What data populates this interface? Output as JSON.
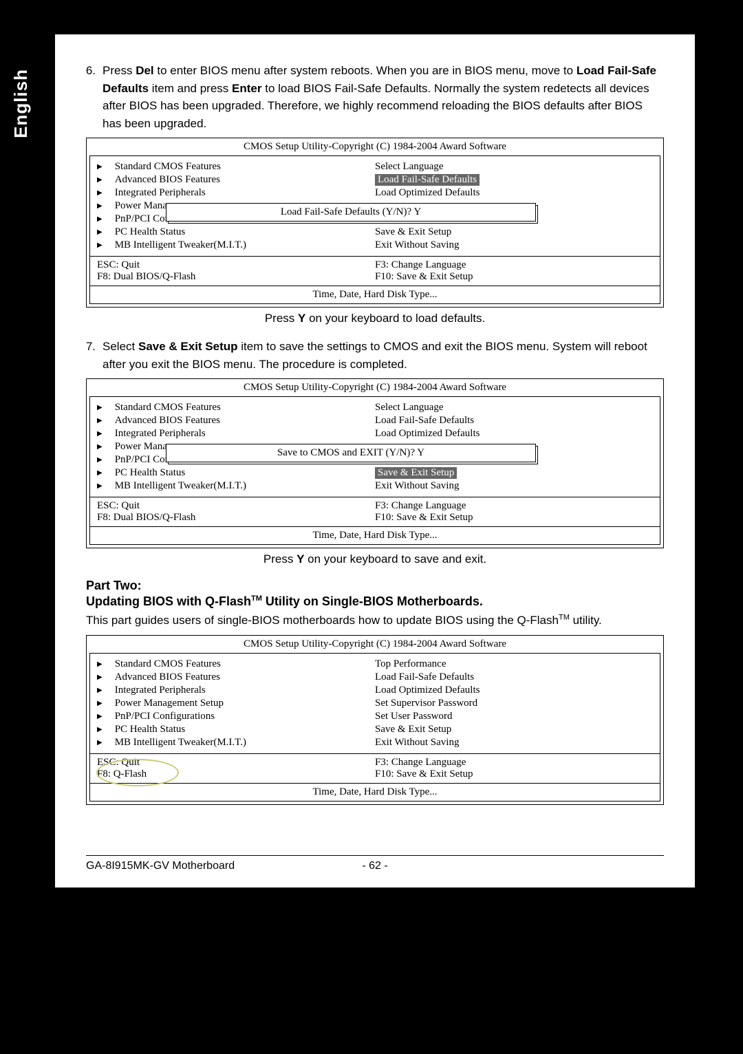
{
  "lang_tab": "English",
  "step6": {
    "num": "6.",
    "t1": "Press ",
    "b1": "Del",
    "t2": " to enter BIOS menu after system reboots. When you are in BIOS menu, move to ",
    "b2": "Load Fail-Safe Defaults",
    "t3": " item and press ",
    "b3": "Enter",
    "t4": " to load BIOS Fail-Safe Defaults. Normally the system redetects all devices after BIOS has been upgraded. Therefore, we highly recommend reloading the BIOS defaults after BIOS has been upgraded."
  },
  "bios1": {
    "title": "CMOS Setup Utility-Copyright (C) 1984-2004 Award Software",
    "left": [
      "Standard CMOS Features",
      "Advanced BIOS Features",
      "Integrated Peripherals",
      "Power Mana",
      "PnP/PCI Cor",
      "PC Health Status",
      "MB Intelligent Tweaker(M.I.T.)"
    ],
    "right": [
      "Select Language",
      "Load Fail-Safe Defaults",
      "Load Optimized Defaults",
      "",
      "",
      "Save & Exit Setup",
      "Exit Without Saving"
    ],
    "right_sel_index": 1,
    "dialog": "Load Fail-Safe Defaults (Y/N)? Y",
    "hints": [
      "ESC: Quit",
      "F3: Change Language",
      "F8: Dual BIOS/Q-Flash",
      "F10: Save & Exit Setup"
    ],
    "footer": "Time, Date, Hard Disk Type..."
  },
  "caption1": {
    "t1": "Press ",
    "b": "Y",
    "t2": " on your keyboard to load defaults."
  },
  "step7": {
    "num": "7.",
    "t1": "Select ",
    "b1": "Save & Exit Setup",
    "t2": " item to save the settings to CMOS and exit the BIOS menu. System will reboot after you exit the BIOS menu. The procedure is completed."
  },
  "bios2": {
    "title": "CMOS Setup Utility-Copyright (C) 1984-2004 Award Software",
    "left": [
      "Standard CMOS Features",
      "Advanced BIOS Features",
      "Integrated Peripherals",
      "Power Mana",
      "PnP/PCI Cor",
      "PC Health Status",
      "MB Intelligent Tweaker(M.I.T.)"
    ],
    "right": [
      "Select Language",
      "Load Fail-Safe Defaults",
      "Load Optimized Defaults",
      "",
      "",
      "Save & Exit Setup",
      "Exit Without Saving"
    ],
    "right_sel_index": 5,
    "dialog": "Save to CMOS and EXIT (Y/N)? Y",
    "hints": [
      "ESC: Quit",
      "F3: Change Language",
      "F8: Dual BIOS/Q-Flash",
      "F10: Save & Exit Setup"
    ],
    "footer": "Time, Date, Hard Disk Type..."
  },
  "caption2": {
    "t1": "Press ",
    "b": "Y",
    "t2": " on your keyboard to save and exit."
  },
  "part_two": "Part Two:",
  "part_two_sub": {
    "t1": "Updating BIOS with Q-Flash",
    "t2": " Utility on Single-BIOS Motherboards."
  },
  "part_two_para": {
    "t1": "This part guides users of single-BIOS motherboards how to update BIOS using the Q-Flash",
    "t2": " utility."
  },
  "bios3": {
    "title": "CMOS Setup Utility-Copyright (C) 1984-2004 Award Software",
    "left": [
      "Standard CMOS Features",
      "Advanced BIOS Features",
      "Integrated Peripherals",
      "Power Management Setup",
      "PnP/PCI Configurations",
      "PC Health Status",
      "MB Intelligent Tweaker(M.I.T.)"
    ],
    "right": [
      "Top Performance",
      "Load Fail-Safe Defaults",
      "Load Optimized Defaults",
      "Set Supervisor Password",
      "Set User Password",
      "Save & Exit Setup",
      "Exit Without Saving"
    ],
    "hints": [
      "ESC: Quit",
      "F3: Change Language",
      "F8: Q-Flash",
      "F10: Save & Exit Setup"
    ],
    "footer": "Time, Date, Hard Disk Type..."
  },
  "footer": {
    "left": "GA-8I915MK-GV Motherboard",
    "page": "- 62 -"
  },
  "tm": "TM"
}
